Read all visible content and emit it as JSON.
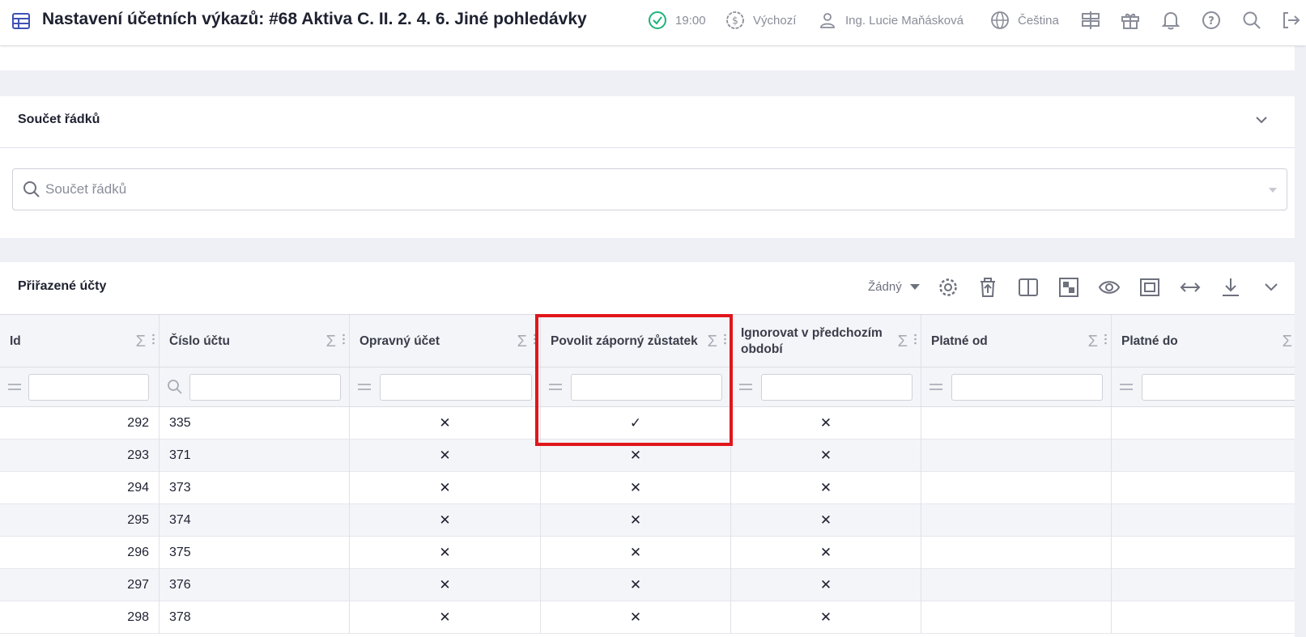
{
  "header": {
    "title": "Nastavení účetních výkazů: #68 Aktiva C. II. 2. 4. 6. Jiné pohledávky",
    "time": "19:00",
    "currency": "Výchozí",
    "user": "Ing. Lucie Maňásková",
    "language": "Čeština"
  },
  "sum_panel": {
    "title": "Součet řádků",
    "search_placeholder": "Součet řádků"
  },
  "accounts_panel": {
    "title": "Přiřazené účty",
    "group_select": "Žádný"
  },
  "table": {
    "columns": [
      "Id",
      "Číslo účtu",
      "Opravný účet",
      "Povolit záporný zůstatek",
      "Ignorovat v předchozím období",
      "Platné od",
      "Platné do"
    ],
    "rows": [
      {
        "id": "292",
        "account": "335",
        "correction": "✕",
        "negative": "✓",
        "ignore": "✕",
        "from": "",
        "to": ""
      },
      {
        "id": "293",
        "account": "371",
        "correction": "✕",
        "negative": "✕",
        "ignore": "✕",
        "from": "",
        "to": ""
      },
      {
        "id": "294",
        "account": "373",
        "correction": "✕",
        "negative": "✕",
        "ignore": "✕",
        "from": "",
        "to": ""
      },
      {
        "id": "295",
        "account": "374",
        "correction": "✕",
        "negative": "✕",
        "ignore": "✕",
        "from": "",
        "to": ""
      },
      {
        "id": "296",
        "account": "375",
        "correction": "✕",
        "negative": "✕",
        "ignore": "✕",
        "from": "",
        "to": ""
      },
      {
        "id": "297",
        "account": "376",
        "correction": "✕",
        "negative": "✕",
        "ignore": "✕",
        "from": "",
        "to": ""
      },
      {
        "id": "298",
        "account": "378",
        "correction": "✕",
        "negative": "✕",
        "ignore": "✕",
        "from": "",
        "to": ""
      }
    ]
  },
  "colors": {
    "accent": "#3f51b5",
    "success": "#1bb57a",
    "highlight": "#e0161b"
  }
}
